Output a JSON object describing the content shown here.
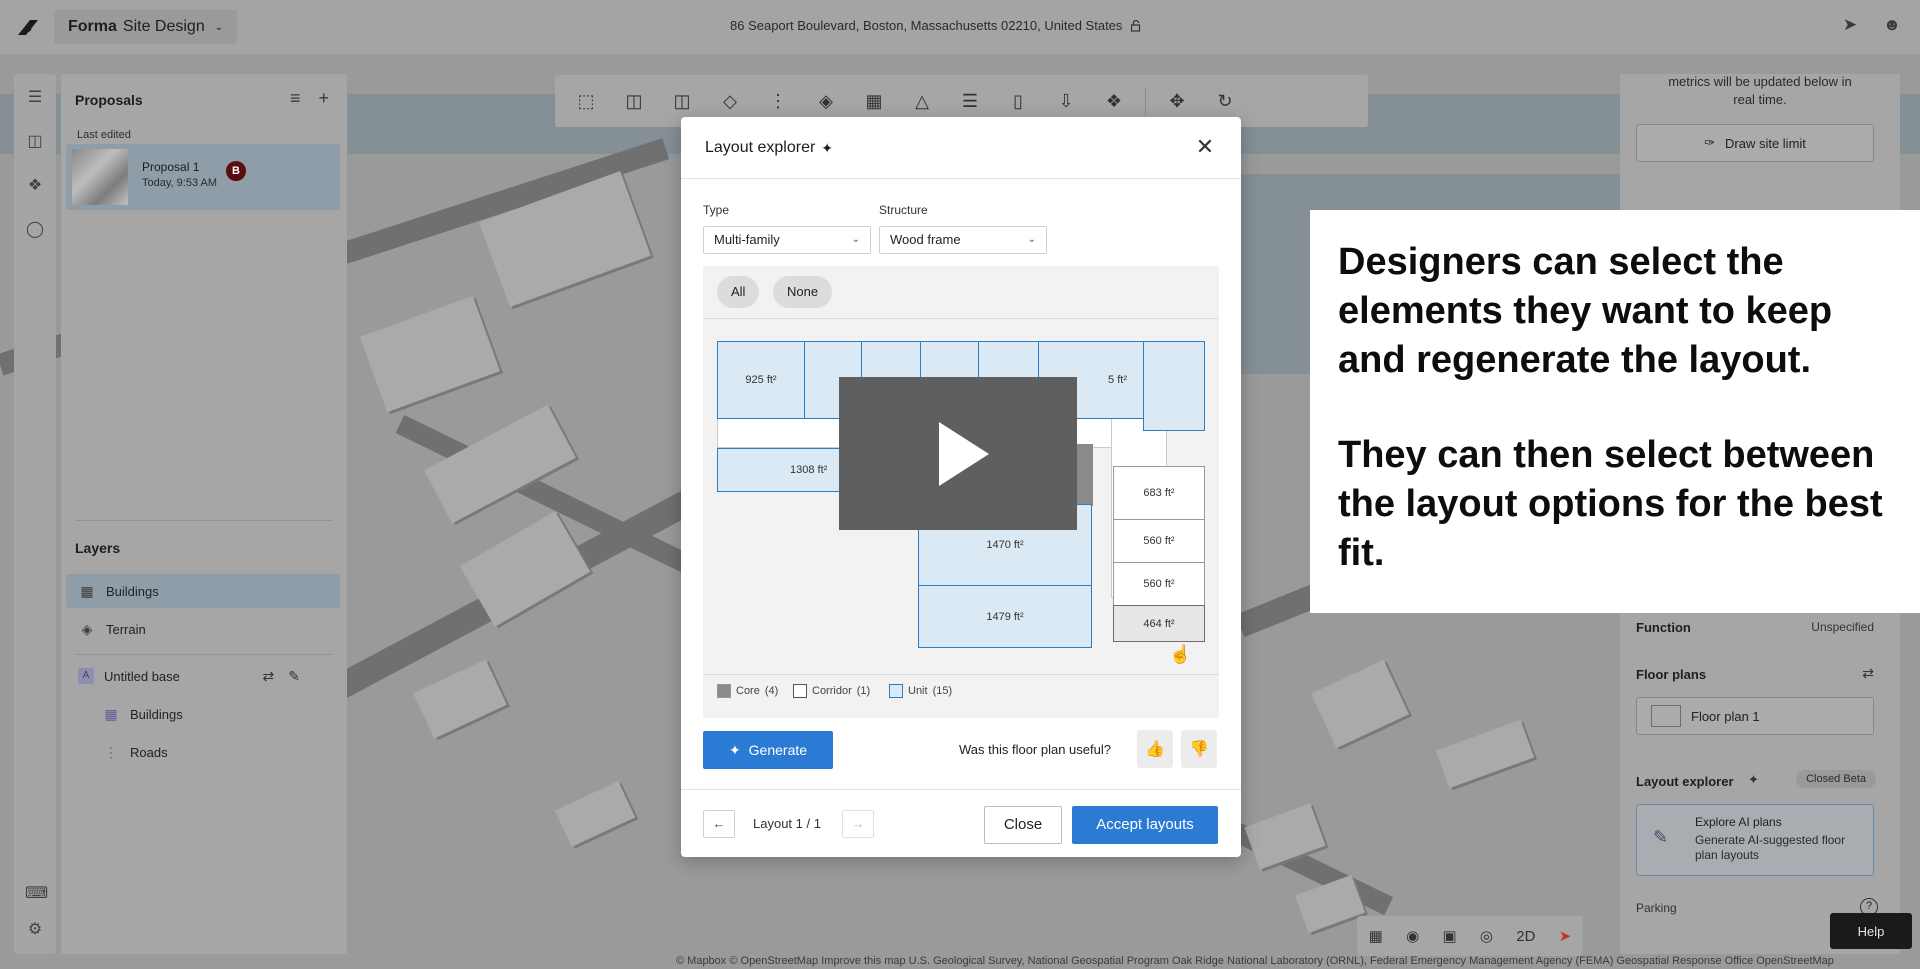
{
  "app": {
    "name_bold": "Forma",
    "name_rest": "Site Design"
  },
  "address": "86 Seaport Boulevard, Boston, Massachusetts 02210, United States",
  "proposals": {
    "title": "Proposals",
    "section": "Last edited",
    "items": [
      {
        "name": "Proposal 1",
        "time": "Today, 9:53 AM",
        "badge": "B"
      }
    ]
  },
  "layers": {
    "title": "Layers",
    "items": [
      {
        "label": "Buildings",
        "icon": "buildings-layer-icon",
        "selected": true
      },
      {
        "label": "Terrain",
        "icon": "terrain-layer-icon"
      },
      {
        "label": "Untitled base",
        "icon": "base-a-icon",
        "letter": "A"
      },
      {
        "label": "Buildings",
        "icon": "buildings-layer-icon"
      },
      {
        "label": "Roads",
        "icon": "roads-layer-icon"
      }
    ]
  },
  "right_panel": {
    "intro_line1": "metrics will be updated below in",
    "intro_line2": "real time.",
    "draw_site_limit": "Draw site limit",
    "function_label": "Function",
    "function_value": "Unspecified",
    "floor_plans_label": "Floor plans",
    "floor_plan_item": "Floor plan 1",
    "layout_explorer_label": "Layout explorer",
    "closed_beta": "Closed Beta",
    "explore_title": "Explore AI plans",
    "explore_desc": "Generate AI-suggested floor plan layouts",
    "parking_label": "Parking",
    "help": "Help"
  },
  "nav_2d": "2D",
  "modal": {
    "title": "Layout explorer",
    "type_label": "Type",
    "type_value": "Multi-family",
    "structure_label": "Structure",
    "structure_value": "Wood frame",
    "pill_all": "All",
    "pill_none": "None",
    "rooms": {
      "r925": "925 ft²",
      "r_5": "5 ft²",
      "r1308": "1308 ft²",
      "r683": "683 ft²",
      "r1470": "1470 ft²",
      "r560a": "560 ft²",
      "r560b": "560 ft²",
      "r1479": "1479 ft²",
      "r464": "464 ft²"
    },
    "legend": {
      "core": "Core",
      "core_count": "(4)",
      "corridor": "Corridor",
      "corridor_count": "(1)",
      "unit": "Unit",
      "unit_count": "(15)"
    },
    "generate": "Generate",
    "useful_q": "Was this floor plan useful?",
    "pager": "Layout 1 / 1",
    "close": "Close",
    "accept": "Accept layouts"
  },
  "caption": {
    "p1": "Designers can select the elements they want to keep and regenerate the layout.",
    "p2": "They can then select between the layout options for the best fit."
  },
  "attribution": "© Mapbox © OpenStreetMap Improve this map U.S. Geological Survey, National Geospatial Program Oak Ridge National Laboratory (ORNL), Federal Emergency Management Agency (FEMA) Geospatial Response Office OpenStreetMap",
  "colors": {
    "accent": "#2b7bd4",
    "unit_fill": "#dbe9f5",
    "unit_stroke": "#2d7cc4",
    "badge": "#5b0d0d"
  }
}
